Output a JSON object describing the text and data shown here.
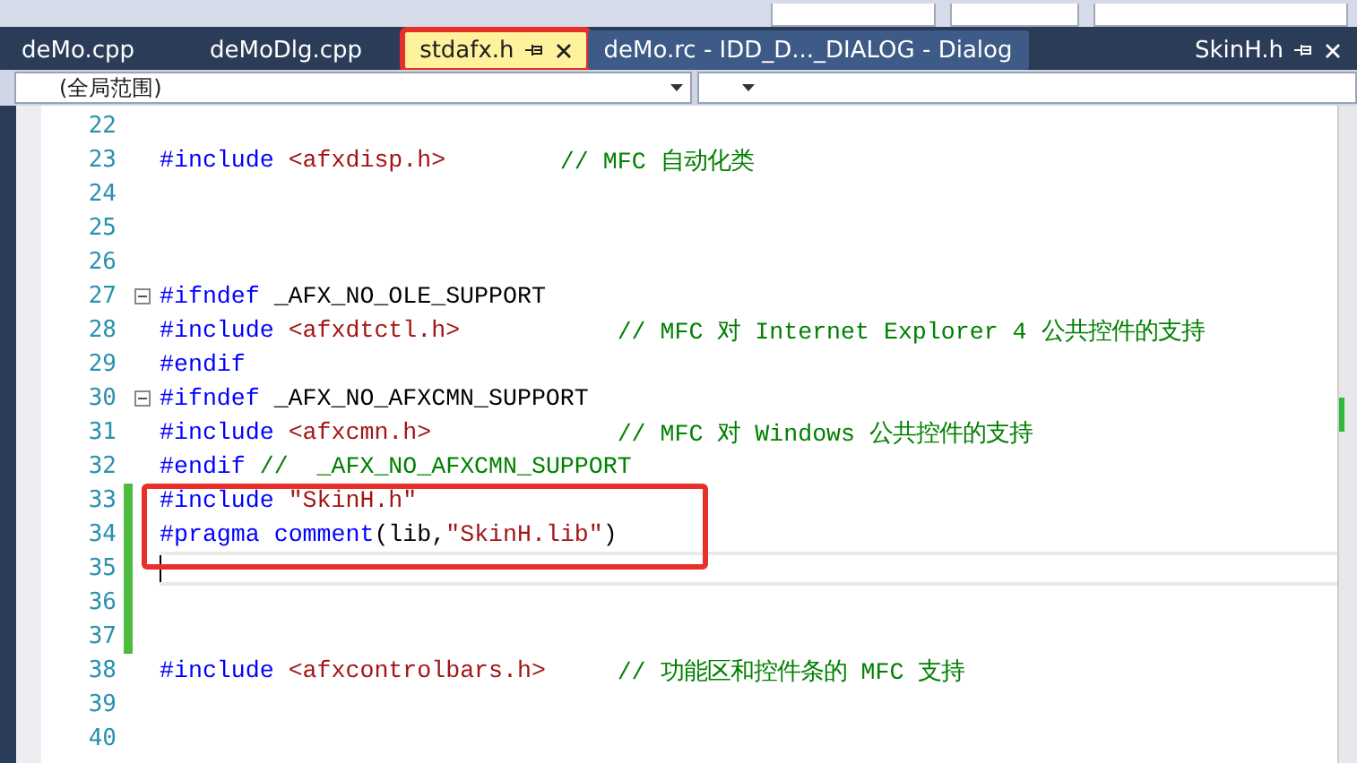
{
  "tabs": [
    {
      "label": "deMo.cpp",
      "selected": false
    },
    {
      "label": "deMoDlg.cpp",
      "selected": false
    },
    {
      "label": "stdafx.h",
      "selected": true,
      "pinned": true,
      "annotated": true
    },
    {
      "label": "deMo.rc - IDD_D..._DIALOG - Dialog",
      "selected": false,
      "hovered": true
    }
  ],
  "side_tab": {
    "label": "SkinH.h"
  },
  "navigation": {
    "scope": "(全局范围)"
  },
  "lines": [
    {
      "number": "22"
    },
    {
      "number": "23",
      "tokens": [
        {
          "kind": "directive",
          "text": "#include"
        },
        {
          "kind": "header",
          "text": "<afxdisp.h>"
        }
      ],
      "comment": "// MFC 自动化类"
    },
    {
      "number": "24"
    },
    {
      "number": "25"
    },
    {
      "number": "26"
    },
    {
      "number": "27",
      "tokens": [
        {
          "kind": "directive",
          "text": "#ifndef"
        },
        {
          "kind": "plain",
          "text": "_AFX_NO_OLE_SUPPORT"
        }
      ],
      "foldable": true
    },
    {
      "number": "28",
      "tokens": [
        {
          "kind": "directive",
          "text": "#include"
        },
        {
          "kind": "header",
          "text": "<afxdtctl.h>"
        }
      ],
      "comment": "// MFC 对 Internet Explorer 4 公共控件的支持"
    },
    {
      "number": "29",
      "tokens": [
        {
          "kind": "directive",
          "text": "#endif"
        }
      ]
    },
    {
      "number": "30",
      "tokens": [
        {
          "kind": "directive",
          "text": "#ifndef"
        },
        {
          "kind": "plain",
          "text": "_AFX_NO_AFXCMN_SUPPORT"
        }
      ],
      "foldable": true
    },
    {
      "number": "31",
      "tokens": [
        {
          "kind": "directive",
          "text": "#include"
        },
        {
          "kind": "header",
          "text": "<afxcmn.h>"
        }
      ],
      "comment": "// MFC 对 Windows 公共控件的支持"
    },
    {
      "number": "32",
      "tokens": [
        {
          "kind": "directive",
          "text": "#endif"
        },
        {
          "kind": "comment",
          "text": "//  _AFX_NO_AFXCMN_SUPPORT"
        }
      ]
    },
    {
      "number": "33",
      "tokens": [
        {
          "kind": "directive",
          "text": "#include"
        },
        {
          "kind": "header",
          "text": "\"SkinH.h\""
        }
      ],
      "changed": true,
      "annotated": true
    },
    {
      "number": "34",
      "tokens": [
        {
          "kind": "directive",
          "text": "#pragma comment"
        },
        {
          "kind": "plain",
          "text": "(lib,",
          "joined": true
        },
        {
          "kind": "header",
          "text": "\"SkinH.lib\"",
          "joined": true
        },
        {
          "kind": "plain",
          "text": ")",
          "joined": true
        }
      ],
      "changed": true,
      "annotated": true
    },
    {
      "number": "35",
      "changed": true,
      "current": true
    },
    {
      "number": "36",
      "changed": true
    },
    {
      "number": "37",
      "changed": true
    },
    {
      "number": "38",
      "tokens": [
        {
          "kind": "directive",
          "text": "#include"
        },
        {
          "kind": "header",
          "text": "<afxcontrolbars.h>"
        }
      ],
      "comment": "// 功能区和控件条的 MFC 支持"
    },
    {
      "number": "39"
    },
    {
      "number": "40"
    }
  ]
}
